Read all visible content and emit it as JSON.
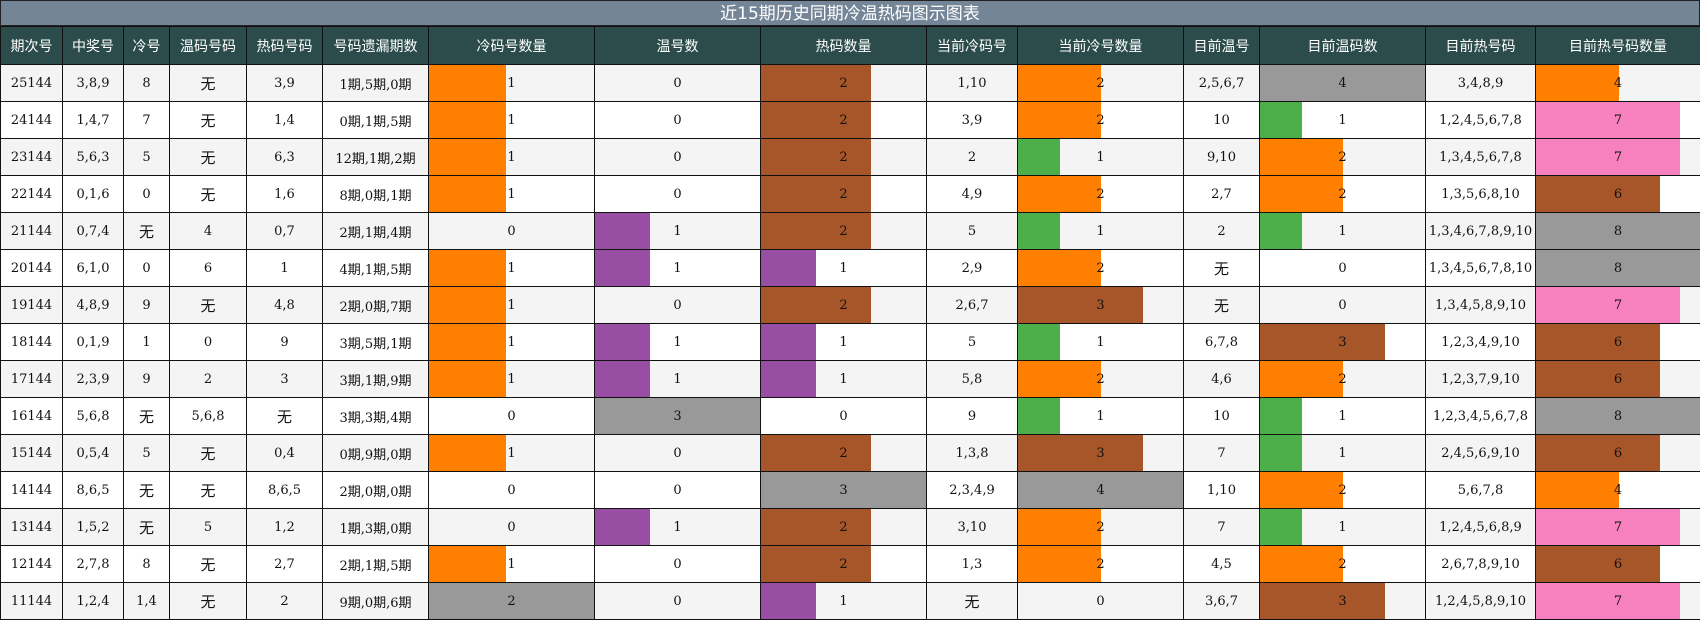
{
  "title": "近15期历史同期冷温热码图示图表",
  "headers": [
    "期次号",
    "中奖号",
    "冷号",
    "温码号码",
    "热码号码",
    "号码遗漏期数",
    "冷码号数量",
    "温号数",
    "热码数量",
    "当前冷码号",
    "当前冷号数量",
    "目前温号",
    "目前温码数",
    "目前热号码",
    "目前热号码数量"
  ],
  "colors": {
    "orange": "#ff7f00",
    "purple": "#984ea3",
    "brown": "#a65628",
    "gray": "#999999",
    "green": "#4daf4a",
    "pink": "#f781bf"
  },
  "rows": [
    [
      "25144",
      "3,8,9",
      "8",
      "无",
      "3,9",
      "1期,5期,0期",
      1,
      0,
      2,
      "1,10",
      2,
      "2,5,6,7",
      4,
      "3,4,8,9",
      4
    ],
    [
      "24144",
      "1,4,7",
      "7",
      "无",
      "1,4",
      "0期,1期,5期",
      1,
      0,
      2,
      "3,9",
      2,
      "10",
      1,
      "1,2,4,5,6,7,8",
      7
    ],
    [
      "23144",
      "5,6,3",
      "5",
      "无",
      "6,3",
      "12期,1期,2期",
      1,
      0,
      2,
      "2",
      1,
      "9,10",
      2,
      "1,3,4,5,6,7,8",
      7
    ],
    [
      "22144",
      "0,1,6",
      "0",
      "无",
      "1,6",
      "8期,0期,1期",
      1,
      0,
      2,
      "4,9",
      2,
      "2,7",
      2,
      "1,3,5,6,8,10",
      6
    ],
    [
      "21144",
      "0,7,4",
      "无",
      "4",
      "0,7",
      "2期,1期,4期",
      0,
      1,
      2,
      "5",
      1,
      "2",
      1,
      "1,3,4,6,7,8,9,10",
      8
    ],
    [
      "20144",
      "6,1,0",
      "0",
      "6",
      "1",
      "4期,1期,5期",
      1,
      1,
      1,
      "2,9",
      2,
      "无",
      0,
      "1,3,4,5,6,7,8,10",
      8
    ],
    [
      "19144",
      "4,8,9",
      "9",
      "无",
      "4,8",
      "2期,0期,7期",
      1,
      0,
      2,
      "2,6,7",
      3,
      "无",
      0,
      "1,3,4,5,8,9,10",
      7
    ],
    [
      "18144",
      "0,1,9",
      "1",
      "0",
      "9",
      "3期,5期,1期",
      1,
      1,
      1,
      "5",
      1,
      "6,7,8",
      3,
      "1,2,3,4,9,10",
      6
    ],
    [
      "17144",
      "2,3,9",
      "9",
      "2",
      "3",
      "3期,1期,9期",
      1,
      1,
      1,
      "5,8",
      2,
      "4,6",
      2,
      "1,2,3,7,9,10",
      6
    ],
    [
      "16144",
      "5,6,8",
      "无",
      "5,6,8",
      "无",
      "3期,3期,4期",
      0,
      3,
      0,
      "9",
      1,
      "10",
      1,
      "1,2,3,4,5,6,7,8",
      8
    ],
    [
      "15144",
      "0,5,4",
      "5",
      "无",
      "0,4",
      "0期,9期,0期",
      1,
      0,
      2,
      "1,3,8",
      3,
      "7",
      1,
      "2,4,5,6,9,10",
      6
    ],
    [
      "14144",
      "8,6,5",
      "无",
      "无",
      "8,6,5",
      "2期,0期,0期",
      0,
      0,
      3,
      "2,3,4,9",
      4,
      "1,10",
      2,
      "5,6,7,8",
      4
    ],
    [
      "13144",
      "1,5,2",
      "无",
      "5",
      "1,2",
      "1期,3期,0期",
      0,
      1,
      2,
      "3,10",
      2,
      "7",
      1,
      "1,2,4,5,6,8,9",
      7
    ],
    [
      "12144",
      "2,7,8",
      "8",
      "无",
      "2,7",
      "2期,1期,5期",
      1,
      0,
      2,
      "1,3",
      2,
      "4,5",
      2,
      "2,6,7,8,9,10",
      6
    ],
    [
      "11144",
      "1,2,4",
      "1,4",
      "无",
      "2",
      "9期,0期,6期",
      2,
      0,
      1,
      "无",
      0,
      "3,6,7",
      3,
      "1,2,4,5,8,9,10",
      7
    ]
  ]
}
